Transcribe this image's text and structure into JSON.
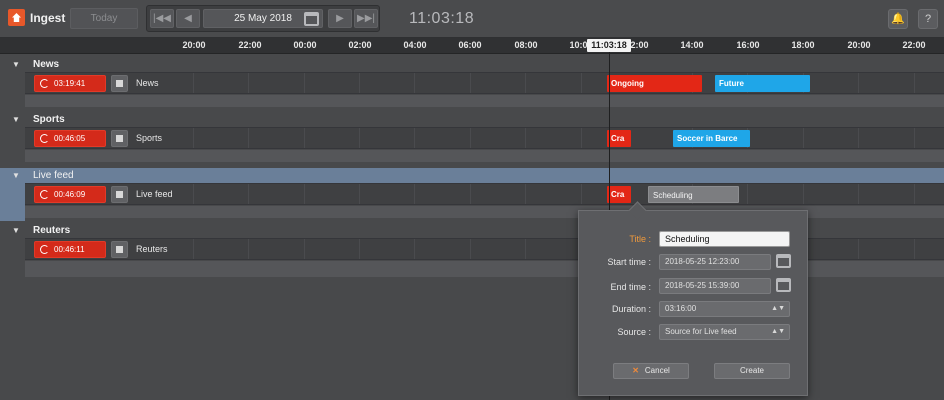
{
  "app": {
    "title": "Ingest"
  },
  "toolbar": {
    "today_label": "Today",
    "date": "25 May 2018",
    "first_label": "|◀◀",
    "prev_label": "◀",
    "next_label": "▶",
    "last_label": "▶▶|",
    "clock": "11:03:18",
    "notify_label": "🔔",
    "help_label": "?"
  },
  "ruler": {
    "ticks": [
      "20:00",
      "22:00",
      "00:00",
      "02:00",
      "04:00",
      "06:00",
      "08:00",
      "10:00",
      "12:00",
      "14:00",
      "16:00",
      "18:00",
      "20:00",
      "22:00"
    ],
    "now": "11:03:18"
  },
  "groups": [
    {
      "name": "News",
      "timer": "03:19:41",
      "channel": "News",
      "events": [
        {
          "label": "Ongoing",
          "color": "#e32716"
        },
        {
          "label": "Future",
          "color": "#1fa6e8"
        }
      ]
    },
    {
      "name": "Sports",
      "timer": "00:46:05",
      "channel": "Sports",
      "events": [
        {
          "label": "Cra",
          "color": "#e32716"
        },
        {
          "label": "Soccer in Barce",
          "color": "#1fa6e8"
        }
      ]
    },
    {
      "name": "Live feed",
      "timer": "00:46:09",
      "channel": "Live feed",
      "events": [
        {
          "label": "Cra",
          "color": "#e32716"
        },
        {
          "label": "Scheduling",
          "color": "#7c7d80"
        }
      ]
    },
    {
      "name": "Reuters",
      "timer": "00:46:11",
      "channel": "Reuters",
      "events": []
    }
  ],
  "dialog": {
    "title_label": "Title :",
    "title_value": "Scheduling",
    "start_label": "Start time :",
    "start_value": "2018-05-25 12:23:00",
    "end_label": "End time :",
    "end_value": "2018-05-25 15:39:00",
    "duration_label": "Duration :",
    "duration_value": "03:16:00",
    "source_label": "Source :",
    "source_value": "Source for Live feed",
    "cancel_label": "Cancel",
    "create_label": "Create"
  }
}
